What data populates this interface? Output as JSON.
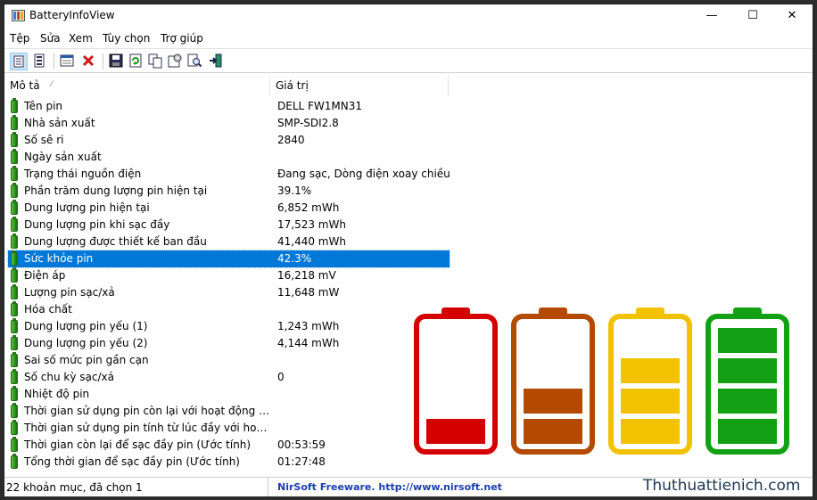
{
  "window": {
    "title": "BatteryInfoView",
    "controls": {
      "minimize": "—",
      "maximize": "☐",
      "close": "✕"
    }
  },
  "menu": [
    "Tệp",
    "Sửa",
    "Xem",
    "Tùy chọn",
    "Trợ giúp"
  ],
  "toolbar": {
    "buttons": [
      "battery-info-view-icon",
      "log-view-icon",
      "properties-window-icon",
      "delete-icon",
      "save-icon",
      "refresh-icon",
      "copy-icon",
      "options-icon",
      "find-icon",
      "exit-icon"
    ]
  },
  "columns": {
    "desc": "Mô tả",
    "value": "Giá trị",
    "sort_indicator": "⁄"
  },
  "rows": [
    {
      "desc": "Tên pin",
      "value": "DELL FW1MN31"
    },
    {
      "desc": "Nhà sản xuất",
      "value": "SMP-SDI2.8"
    },
    {
      "desc": "Số sê ri",
      "value": " 2840"
    },
    {
      "desc": "Ngày sản xuất",
      "value": ""
    },
    {
      "desc": "Trạng thái nguồn điện",
      "value": "Đang sạc, Dòng điện xoay chiều"
    },
    {
      "desc": "Phần trăm dung lượng pin hiện tại",
      "value": "39.1%"
    },
    {
      "desc": "Dung lượng pin hiện tại",
      "value": "6,852 mWh"
    },
    {
      "desc": "Dung lượng pin khi sạc đầy",
      "value": "17,523 mWh"
    },
    {
      "desc": "Dung lượng được thiết kế ban đầu",
      "value": "41,440 mWh"
    },
    {
      "desc": "Sức khỏe pin",
      "value": "42.3%",
      "selected": true
    },
    {
      "desc": "Điện áp",
      "value": "16,218 mV"
    },
    {
      "desc": "Lượng pin sạc/xả",
      "value": "11,648 mW"
    },
    {
      "desc": "Hóa chất",
      "value": ""
    },
    {
      "desc": "Dung lượng pin yếu (1)",
      "value": "1,243 mWh"
    },
    {
      "desc": "Dung lượng pin yếu (2)",
      "value": "4,144 mWh"
    },
    {
      "desc": "Sai số mức pin gần cạn",
      "value": ""
    },
    {
      "desc": "Số chu kỳ sạc/xả",
      "value": "0"
    },
    {
      "desc": "Nhiệt độ pin",
      "value": ""
    },
    {
      "desc": "Thời gian sử dụng pin còn lại với hoạt động hiện t...",
      "value": ""
    },
    {
      "desc": "Thời gian sử dụng pin tính từ lúc đầy với hoạt độn...",
      "value": ""
    },
    {
      "desc": "Thời gian còn lại để sạc đầy pin (Ước tính)",
      "value": "00:53:59"
    },
    {
      "desc": "Tổng thời gian để sạc đầy pin (Ước tính)",
      "value": "01:27:48"
    }
  ],
  "status": {
    "items": "22 khoản mục, đã chọn 1",
    "credit": "NirSoft Freeware.  http://www.nirsoft.net"
  },
  "watermark": "Thuthuattienich.com",
  "battery_graphics": [
    {
      "color": "#d40000",
      "level": 0.2
    },
    {
      "color": "#b34a00",
      "level": 0.4
    },
    {
      "color": "#f2c200",
      "level": 0.6
    },
    {
      "color": "#14a014",
      "level": 0.8
    }
  ]
}
